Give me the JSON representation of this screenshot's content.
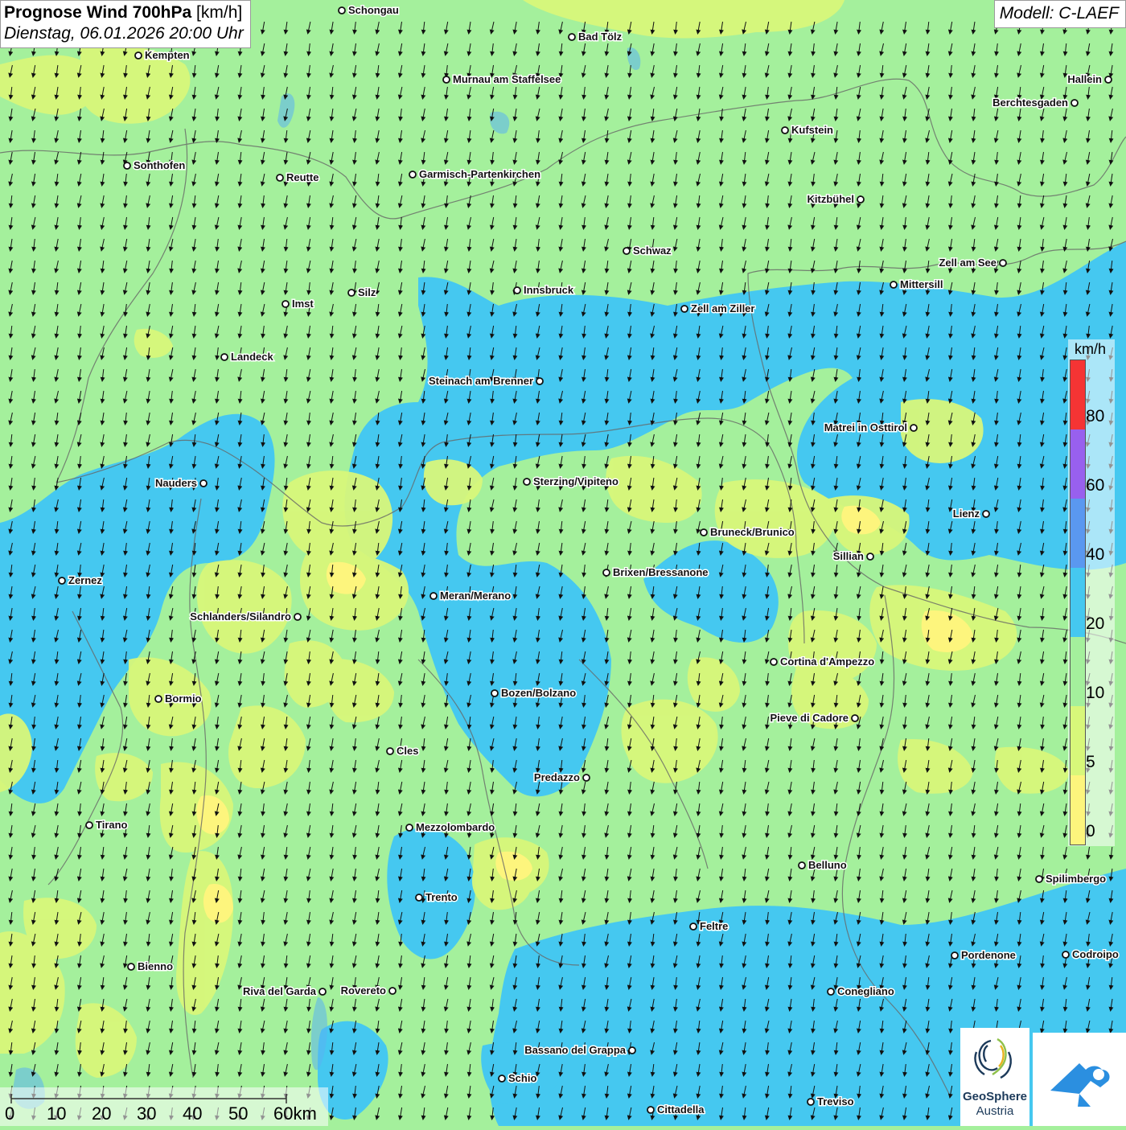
{
  "title": {
    "main": "Prognose Wind 700hPa",
    "unit": "[km/h]",
    "datetime": "Dienstag, 06.01.2026 20:00 Uhr"
  },
  "model": "Modell: C-LAEF",
  "legend": {
    "unit": "km/h",
    "bins": [
      {
        "from": 0,
        "to": 5,
        "color": "#fdf57d"
      },
      {
        "from": 5,
        "to": 10,
        "color": "#d8f77a"
      },
      {
        "from": 10,
        "to": 20,
        "color": "#a4f09c"
      },
      {
        "from": 20,
        "to": 40,
        "color": "#45c8f0"
      },
      {
        "from": 40,
        "to": 60,
        "color": "#5a98f0"
      },
      {
        "from": 60,
        "to": 80,
        "color": "#9860ee"
      },
      {
        "from": 80,
        "to": 100,
        "color": "#f53434"
      }
    ],
    "labels": [
      "80",
      "60",
      "40",
      "20",
      "10",
      "5",
      "0"
    ]
  },
  "scale": {
    "labels": [
      "0",
      "10",
      "20",
      "30",
      "40",
      "50",
      "60km"
    ]
  },
  "logos": {
    "geosphere_name": "GeoSphere",
    "geosphere_sub": "Austria"
  },
  "cities": [
    {
      "name": "Schongau"
    },
    {
      "name": "Bad Tölz"
    },
    {
      "name": "Kempten"
    },
    {
      "name": "Hallein"
    },
    {
      "name": "Murnau am Staffelsee"
    },
    {
      "name": "Berchtesgaden"
    },
    {
      "name": "Kufstein"
    },
    {
      "name": "Sonthofen"
    },
    {
      "name": "Reutte"
    },
    {
      "name": "Garmisch-Partenkirchen"
    },
    {
      "name": "Kitzbühel"
    },
    {
      "name": "Schwaz"
    },
    {
      "name": "Zell am See"
    },
    {
      "name": "Mittersill"
    },
    {
      "name": "Innsbruck"
    },
    {
      "name": "Silz"
    },
    {
      "name": "Imst"
    },
    {
      "name": "Zell am Ziller"
    },
    {
      "name": "Landeck"
    },
    {
      "name": "Steinach am Brenner"
    },
    {
      "name": "Matrei in Osttirol"
    },
    {
      "name": "Nauders"
    },
    {
      "name": "Sterzing/Vipiteno"
    },
    {
      "name": "Lienz"
    },
    {
      "name": "Bruneck/Brunico"
    },
    {
      "name": "Sillian"
    },
    {
      "name": "Zernez"
    },
    {
      "name": "Brixen/Bressanone"
    },
    {
      "name": "Meran/Merano"
    },
    {
      "name": "Schlanders/Silandro"
    },
    {
      "name": "Cortina d'Ampezzo"
    },
    {
      "name": "Bozen/Bolzano"
    },
    {
      "name": "Bormio"
    },
    {
      "name": "Pieve di Cadore"
    },
    {
      "name": "Cles"
    },
    {
      "name": "Predazzo"
    },
    {
      "name": "Tirano"
    },
    {
      "name": "Mezzolombardo"
    },
    {
      "name": "Belluno"
    },
    {
      "name": "Spilimbergo"
    },
    {
      "name": "Trento"
    },
    {
      "name": "Feltre"
    },
    {
      "name": "Pordenone"
    },
    {
      "name": "Codroipo"
    },
    {
      "name": "Bienno"
    },
    {
      "name": "Riva del Garda"
    },
    {
      "name": "Rovereto"
    },
    {
      "name": "Conegliano"
    },
    {
      "name": "Bassano del Grappa"
    },
    {
      "name": "Schio"
    },
    {
      "name": "Treviso"
    },
    {
      "name": "Cittadella"
    }
  ]
}
